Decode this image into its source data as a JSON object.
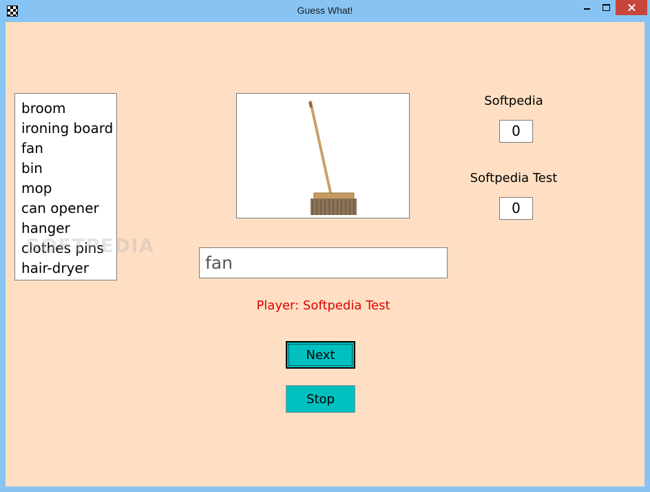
{
  "window": {
    "title": "Guess What!",
    "app_icon": "checkered-flag-icon"
  },
  "word_list": {
    "items": [
      "broom",
      "ironing board",
      "fan",
      "bin",
      "mop",
      "can opener",
      "hanger",
      "clothes pins",
      "hair-dryer"
    ]
  },
  "picture": {
    "subject": "broom-icon"
  },
  "answer": {
    "value": "fan"
  },
  "status": {
    "player_text": "Player: Softpedia Test",
    "color": "#e00000"
  },
  "buttons": {
    "next_label": "Next",
    "stop_label": "Stop",
    "color": "#00c0c0"
  },
  "players": [
    {
      "name": "Softpedia",
      "score": "0"
    },
    {
      "name": "Softpedia Test",
      "score": "0"
    }
  ],
  "watermark": "SOFTPEDIA",
  "colors": {
    "background": "#ffdfc3",
    "titlebar": "#88c4f3",
    "close_button": "#c7463c"
  }
}
